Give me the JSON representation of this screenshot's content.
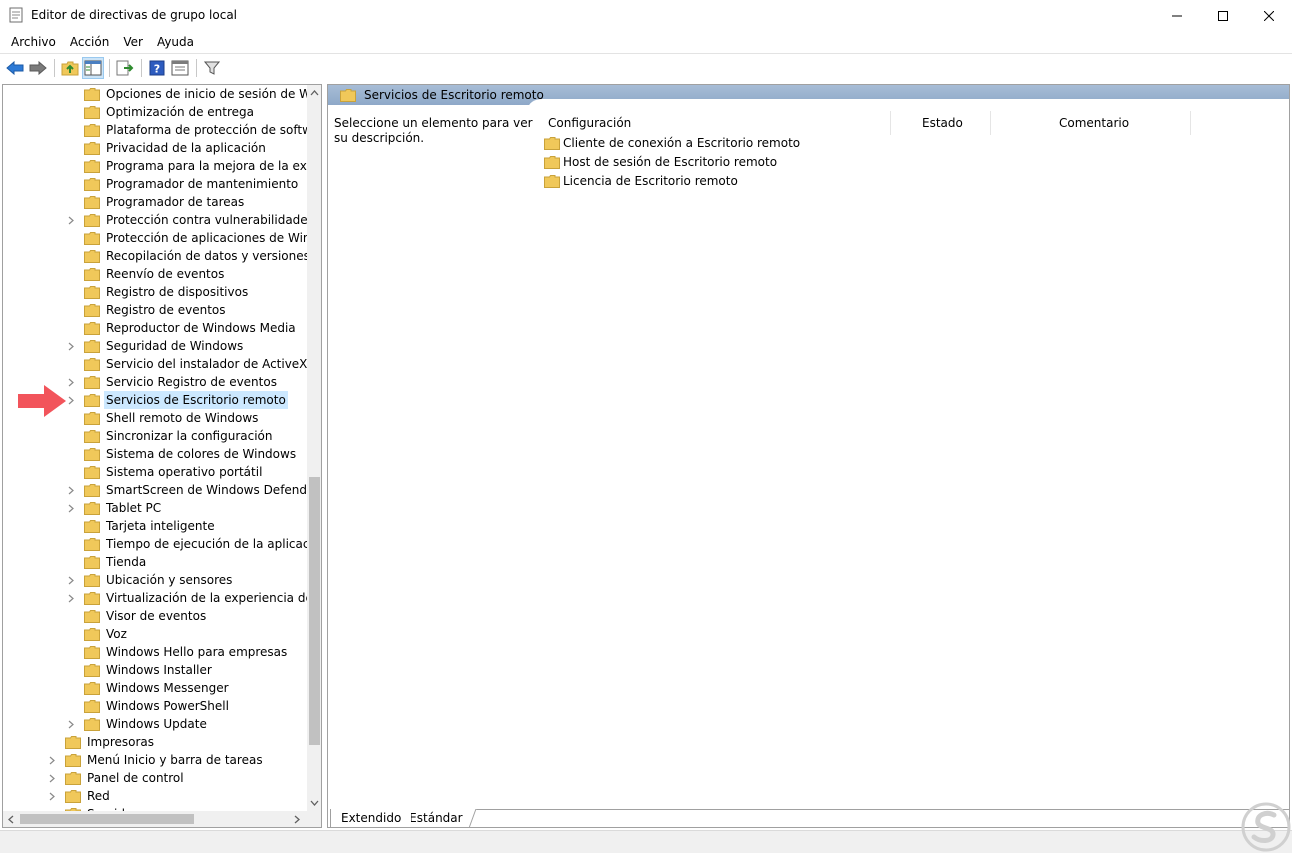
{
  "window": {
    "title": "Editor de directivas de grupo local"
  },
  "menu": [
    "Archivo",
    "Acción",
    "Ver",
    "Ayuda"
  ],
  "tree": {
    "items": [
      {
        "label": "Opciones de inicio de sesión de Windows",
        "level": 2,
        "expandable": false,
        "selected": false
      },
      {
        "label": "Optimización de entrega",
        "level": 2,
        "expandable": false,
        "selected": false
      },
      {
        "label": "Plataforma de protección de software",
        "level": 2,
        "expandable": false,
        "selected": false
      },
      {
        "label": "Privacidad de la aplicación",
        "level": 2,
        "expandable": false,
        "selected": false
      },
      {
        "label": "Programa para la mejora de la experiencia",
        "level": 2,
        "expandable": false,
        "selected": false
      },
      {
        "label": "Programador de mantenimiento",
        "level": 2,
        "expandable": false,
        "selected": false
      },
      {
        "label": "Programador de tareas",
        "level": 2,
        "expandable": false,
        "selected": false
      },
      {
        "label": "Protección contra vulnerabilidades de",
        "level": 2,
        "expandable": true,
        "selected": false
      },
      {
        "label": "Protección de aplicaciones de Windows",
        "level": 2,
        "expandable": false,
        "selected": false
      },
      {
        "label": "Recopilación de datos y versiones preliminares",
        "level": 2,
        "expandable": false,
        "selected": false
      },
      {
        "label": "Reenvío de eventos",
        "level": 2,
        "expandable": false,
        "selected": false
      },
      {
        "label": "Registro de dispositivos",
        "level": 2,
        "expandable": false,
        "selected": false
      },
      {
        "label": "Registro de eventos",
        "level": 2,
        "expandable": false,
        "selected": false
      },
      {
        "label": "Reproductor de Windows Media",
        "level": 2,
        "expandable": false,
        "selected": false
      },
      {
        "label": "Seguridad de Windows",
        "level": 2,
        "expandable": true,
        "selected": false
      },
      {
        "label": "Servicio del instalador de ActiveX",
        "level": 2,
        "expandable": false,
        "selected": false
      },
      {
        "label": "Servicio Registro de eventos",
        "level": 2,
        "expandable": true,
        "selected": false
      },
      {
        "label": "Servicios de Escritorio remoto",
        "level": 2,
        "expandable": true,
        "selected": true
      },
      {
        "label": "Shell remoto de Windows",
        "level": 2,
        "expandable": false,
        "selected": false
      },
      {
        "label": "Sincronizar la configuración",
        "level": 2,
        "expandable": false,
        "selected": false
      },
      {
        "label": "Sistema de colores de Windows",
        "level": 2,
        "expandable": false,
        "selected": false
      },
      {
        "label": "Sistema operativo portátil",
        "level": 2,
        "expandable": false,
        "selected": false
      },
      {
        "label": "SmartScreen de Windows Defender",
        "level": 2,
        "expandable": true,
        "selected": false
      },
      {
        "label": "Tablet PC",
        "level": 2,
        "expandable": true,
        "selected": false
      },
      {
        "label": "Tarjeta inteligente",
        "level": 2,
        "expandable": false,
        "selected": false
      },
      {
        "label": "Tiempo de ejecución de la aplicación",
        "level": 2,
        "expandable": false,
        "selected": false
      },
      {
        "label": "Tienda",
        "level": 2,
        "expandable": false,
        "selected": false
      },
      {
        "label": "Ubicación y sensores",
        "level": 2,
        "expandable": true,
        "selected": false
      },
      {
        "label": "Virtualización de la experiencia del usuario",
        "level": 2,
        "expandable": true,
        "selected": false
      },
      {
        "label": "Visor de eventos",
        "level": 2,
        "expandable": false,
        "selected": false
      },
      {
        "label": "Voz",
        "level": 2,
        "expandable": false,
        "selected": false
      },
      {
        "label": "Windows Hello para empresas",
        "level": 2,
        "expandable": false,
        "selected": false
      },
      {
        "label": "Windows Installer",
        "level": 2,
        "expandable": false,
        "selected": false
      },
      {
        "label": "Windows Messenger",
        "level": 2,
        "expandable": false,
        "selected": false
      },
      {
        "label": "Windows PowerShell",
        "level": 2,
        "expandable": false,
        "selected": false
      },
      {
        "label": "Windows Update",
        "level": 2,
        "expandable": true,
        "selected": false
      },
      {
        "label": "Impresoras",
        "level": 1,
        "expandable": false,
        "selected": false
      },
      {
        "label": "Menú Inicio y barra de tareas",
        "level": 1,
        "expandable": true,
        "selected": false
      },
      {
        "label": "Panel de control",
        "level": 1,
        "expandable": true,
        "selected": false
      },
      {
        "label": "Red",
        "level": 1,
        "expandable": true,
        "selected": false
      },
      {
        "label": "Servidor",
        "level": 1,
        "expandable": false,
        "selected": false
      }
    ]
  },
  "details": {
    "title": "Servicios de Escritorio remoto",
    "description": "Seleccione un elemento para ver su descripción.",
    "columns": [
      "Configuración",
      "Estado",
      "Comentario"
    ],
    "rows": [
      "Cliente de conexión a Escritorio remoto",
      "Host de sesión de Escritorio remoto",
      "Licencia de Escritorio remoto"
    ],
    "tabs": [
      "Extendido",
      "Estándar"
    ]
  },
  "colors": {
    "folder": "#f0c85a",
    "selection": "#cce8ff",
    "banner": "#9bb3d0",
    "arrow": "#f2545b"
  }
}
